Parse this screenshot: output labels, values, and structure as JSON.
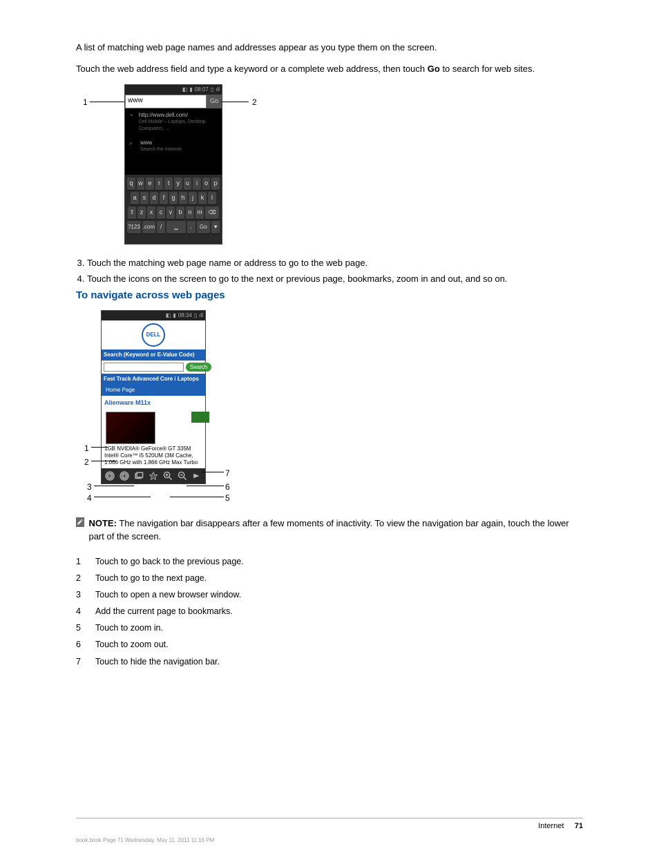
{
  "intro": {
    "p1_a": "A list of matching web page names and addresses appear as you type them on the screen.",
    "p1_b": "Touch the web address field and type a keyword or a complete web address, then touch ",
    "p1_b_strong": "Go",
    "p1_b_end": " to search for web sites."
  },
  "fig1": {
    "status_time": "08:07",
    "url_value": "www",
    "go_label": "Go",
    "sugg1_url": "http://www.dell.com/",
    "sugg1_sub": "Dell Mobile – Laptops, Desktop Computers, …",
    "sugg2_title": "www",
    "sugg2_sub": "Search the Internet",
    "callouts": {
      "left": "1",
      "right": "2"
    }
  },
  "steps": {
    "s3": "Touch the matching web page name or address to go to the web page.",
    "s4": "Touch the icons on the screen to go to the next or previous page, bookmarks, zoom in and out, and so on."
  },
  "sec_title": "To navigate across web pages",
  "fig2": {
    "status_time": "08:34",
    "search_label": "Search (Keyword or E-Value Code)",
    "search_btn": "Search",
    "ft_bar": "Fast Track Advanced Core i Laptops",
    "home": "Home Page",
    "prod_link": "Alienware M11x",
    "spec1": "1GB NVIDIA® GeForce® GT 335M",
    "spec2": "Intel® Core™ i5 520UM (3M Cache, 1.066 GHz with 1.866 GHz Max Turbo",
    "callouts": {
      "c1": "1",
      "c2": "2",
      "c3": "3",
      "c4": "4",
      "c5": "5",
      "c6": "6",
      "c7": "7"
    }
  },
  "note": {
    "prefix": "NOTE:",
    "text": " The navigation bar disappears after a few moments of inactivity. To view the navigation bar again, touch the lower part of the screen."
  },
  "legend": [
    {
      "n": "1",
      "t": "Touch to go back to the previous page."
    },
    {
      "n": "2",
      "t": "Touch to go to the next page."
    },
    {
      "n": "3",
      "t": "Touch to open a new browser window."
    },
    {
      "n": "4",
      "t": "Add the current page to bookmarks."
    },
    {
      "n": "5",
      "t": "Touch to zoom in."
    },
    {
      "n": "6",
      "t": "Touch to zoom out."
    },
    {
      "n": "7",
      "t": "Touch to hide the navigation bar."
    }
  ],
  "footer": {
    "section": "Internet",
    "page": "71",
    "bookfile": "book.book  Page 71  Wednesday, May 11, 2011  11:16 PM"
  }
}
